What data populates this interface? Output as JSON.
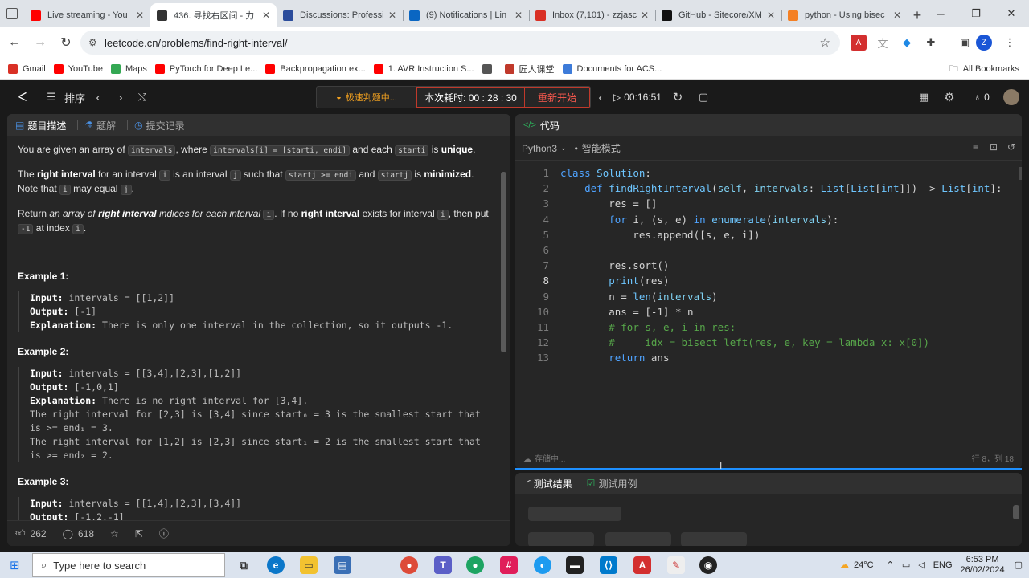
{
  "browser": {
    "tabs": [
      {
        "title": "Live streaming - You",
        "color": "#ff0000"
      },
      {
        "title": "436. 寻找右区间 - 力",
        "color": "#333333",
        "active": true
      },
      {
        "title": "Discussions: Professi",
        "color": "#2b4c9b"
      },
      {
        "title": "(9) Notifications | Lin",
        "color": "#0a66c2"
      },
      {
        "title": "Inbox (7,101) - zzjasc",
        "color": "#d93025"
      },
      {
        "title": "GitHub - Sitecore/XM",
        "color": "#111111"
      },
      {
        "title": "python - Using bisec",
        "color": "#f48024"
      }
    ],
    "url": "leetcode.cn/problems/find-right-interval/",
    "profile_initial": "Z",
    "bookmarks": [
      {
        "label": "Gmail",
        "color": "#d93025"
      },
      {
        "label": "YouTube",
        "color": "#ff0000"
      },
      {
        "label": "Maps",
        "color": "#34a853"
      },
      {
        "label": "PyTorch for Deep Le...",
        "color": "#ff0000"
      },
      {
        "label": "Backpropagation ex...",
        "color": "#ff0000"
      },
      {
        "label": "1. AVR Instruction S...",
        "color": "#ff0000"
      },
      {
        "label": "",
        "color": "#555555"
      },
      {
        "label": "匠人课堂",
        "color": "#c0392b"
      },
      {
        "label": "Documents for ACS...",
        "color": "#3d7bd9"
      }
    ],
    "all_bookmarks": "All Bookmarks"
  },
  "lc": {
    "problem_list": "排序",
    "judge_status": "极速判题中...",
    "timer": "本次耗时: 00 : 28 : 30",
    "restart": "重新开始",
    "stopwatch": "00:16:51",
    "streak": "0"
  },
  "left": {
    "tabs": [
      "题目描述",
      "题解",
      "提交记录"
    ],
    "likes": "262",
    "comments": "618"
  },
  "desc": {
    "p1": {
      "a": "You are given an array of ",
      "c1": "intervals",
      "b": ", where ",
      "c2": "intervals[i] = [starti, endi]",
      "d": " and each ",
      "c3": "starti",
      "e": " is ",
      "f": "unique",
      "g": "."
    },
    "p2": {
      "a": "The ",
      "b": "right interval",
      "c": " for an interval ",
      "c1": "i",
      "d": " is an interval ",
      "c2": "j",
      "e": " such that ",
      "c3": "startj >= endi",
      "f": " and ",
      "c4": "startj",
      "g": " is ",
      "h": "minimized",
      "i": ". Note that ",
      "c5": "i",
      "j": " may equal ",
      "c6": "j",
      "k": "."
    },
    "p3": {
      "a": "Return ",
      "b": "an array of ",
      "c": "right interval",
      "d": " indices for each interval ",
      "c1": "i",
      "e": ". If no ",
      "f": "right interval",
      "g": " exists for interval ",
      "c2": "i",
      "h": ", then put ",
      "c3": "-1",
      "i": " at index ",
      "c4": "i",
      "j": "."
    },
    "ex1_title": "Example 1:",
    "ex2_title": "Example 2:",
    "ex3_title": "Example 3:",
    "labels": {
      "input": "Input:",
      "output": "Output:",
      "explanation": "Explanation:"
    },
    "ex1": {
      "input": " intervals = [[1,2]]",
      "output": " [-1]",
      "explanation": " There is only one interval in the collection, so it outputs -1."
    },
    "ex2": {
      "input": " intervals = [[3,4],[2,3],[1,2]]",
      "output": " [-1,0,1]",
      "explanation": " There is no right interval for [3,4].",
      "l4": "The right interval for [2,3] is [3,4] since start₀ = 3 is the smallest start that",
      "l5": "is >= end₁ = 3.",
      "l6": "The right interval for [1,2] is [2,3] since start₁ = 2 is the smallest start that",
      "l7": "is >= end₂ = 2."
    },
    "ex3": {
      "input": " intervals = [[1,4],[2,3],[3,4]]",
      "output": " [-1,2,-1]"
    }
  },
  "right": {
    "tab": "代码",
    "language": "Python3",
    "mode": "智能模式",
    "saving": "存储中...",
    "cursor": "行 8，列 18"
  },
  "bottom": {
    "tab1": "测试结果",
    "tab2": "测试用例"
  },
  "code_lines": [
    "class Solution:",
    "    def findRightInterval(self, intervals: List[List[int]]) -> List[int]:",
    "        res = []",
    "        for i, (s, e) in enumerate(intervals):",
    "            res.append([s, e, i])",
    "",
    "        res.sort()",
    "        print(res)",
    "        n = len(intervals)",
    "        ans = [-1] * n",
    "        # for s, e, i in res:",
    "        #     idx = bisect_left(res, e, key = lambda x: x[0])",
    "        return ans"
  ],
  "taskbar": {
    "search_placeholder": "Type here to search",
    "temperature": "24°C",
    "lang": "ENG",
    "time": "6:53 PM",
    "date": "26/02/2024"
  }
}
